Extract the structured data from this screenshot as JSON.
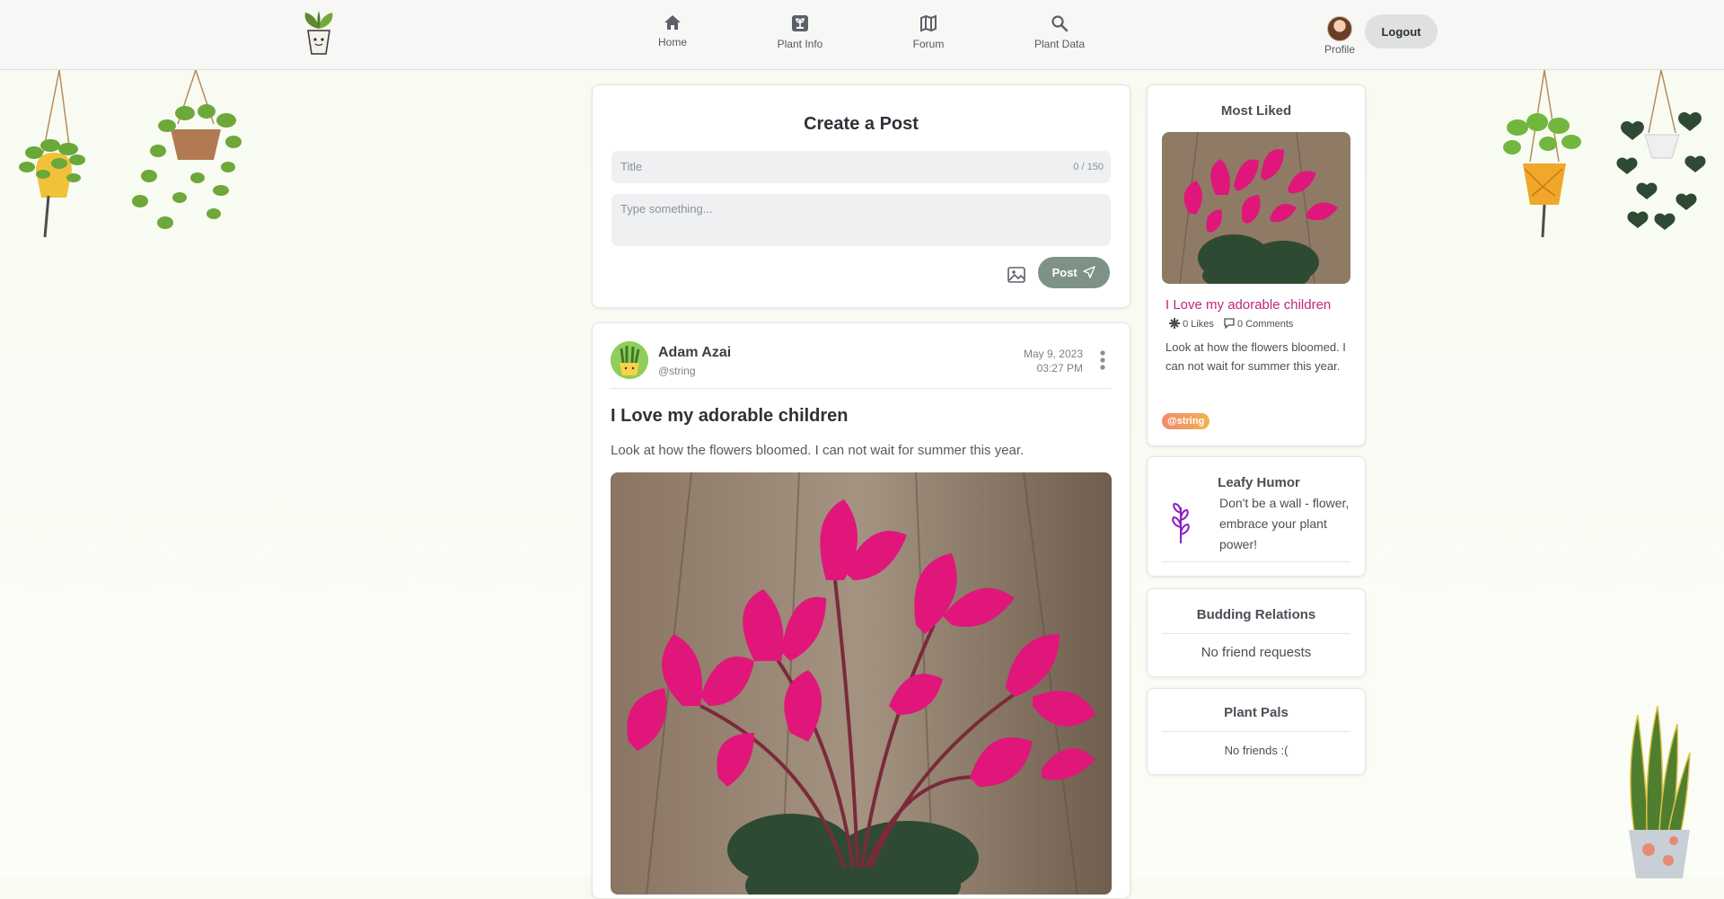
{
  "nav": {
    "items": [
      {
        "label": "Home",
        "icon": "home-icon"
      },
      {
        "label": "Plant Info",
        "icon": "plant-info-icon"
      },
      {
        "label": "Forum",
        "icon": "map-icon"
      },
      {
        "label": "Plant Data",
        "icon": "search-icon"
      }
    ],
    "profile_label": "Profile",
    "logout_label": "Logout"
  },
  "create_post": {
    "heading": "Create a Post",
    "title_placeholder": "Title",
    "title_count": "0 / 150",
    "body_placeholder": "Type something...",
    "post_label": "Post"
  },
  "post": {
    "author": "Adam Azai",
    "handle": "@string",
    "date": "May 9, 2023",
    "time": "03:27 PM",
    "title": "I Love my adorable children",
    "body": "Look at how the flowers bloomed. I can not wait for summer this year."
  },
  "most_liked": {
    "heading": "Most Liked",
    "post_title": "I Love my adorable children",
    "likes": "0 Likes",
    "comments": "0 Comments",
    "body": "Look at how the flowers bloomed. I can not wait for summer this year.",
    "tag": "@string"
  },
  "humor": {
    "heading": "Leafy Humor",
    "text": "Don't be a wall - flower, embrace your plant power!"
  },
  "budding": {
    "heading": "Budding Relations",
    "text": "No friend requests"
  },
  "pals": {
    "heading": "Plant Pals",
    "text": "No friends :("
  },
  "colors": {
    "accent_pink": "#c0267a",
    "post_button": "#7f9288",
    "background": "#f7fbf1"
  }
}
